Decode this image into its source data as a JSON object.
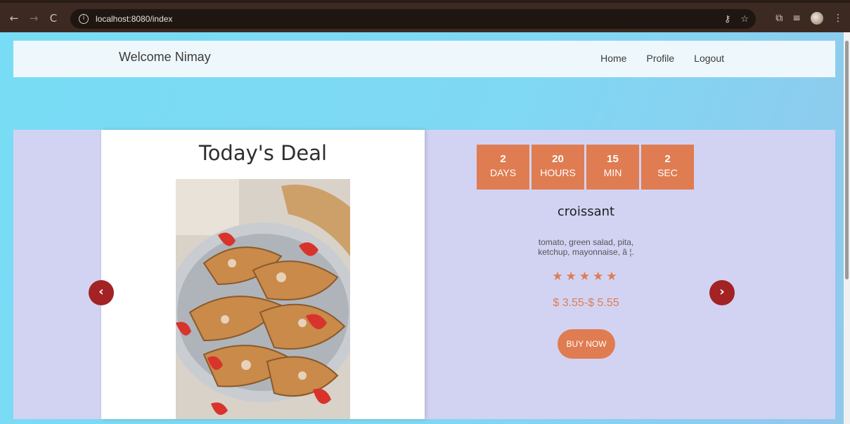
{
  "browser": {
    "url": "localhost:8080/index",
    "back_icon": "←",
    "forward_icon": "→",
    "reload_icon": "C",
    "info_icon": "i"
  },
  "navbar": {
    "brand": "Welcome Nimay",
    "links": [
      "Home",
      "Profile",
      "Logout"
    ]
  },
  "deal": {
    "title": "Today's Deal",
    "countdown": [
      {
        "value": "2",
        "label": "DAYS"
      },
      {
        "value": "20",
        "label": "HOURS"
      },
      {
        "value": "15",
        "label": "MIN"
      },
      {
        "value": "2",
        "label": "SEC"
      }
    ],
    "product_name": "croissant",
    "description": "tomato, green salad, pita, ketchup, mayonnaise, â ¦.",
    "rating_stars": 5,
    "stars_text": "★★★★★",
    "price": "$ 3.55-$ 5.55",
    "buy_label": "BUY NOW",
    "prev_icon": "‹",
    "next_icon": "›"
  },
  "colors": {
    "accent": "#e07c51",
    "arrow": "#a32224",
    "deal_bg": "#d2d3f3",
    "navbar_bg": "#eef7fb"
  }
}
